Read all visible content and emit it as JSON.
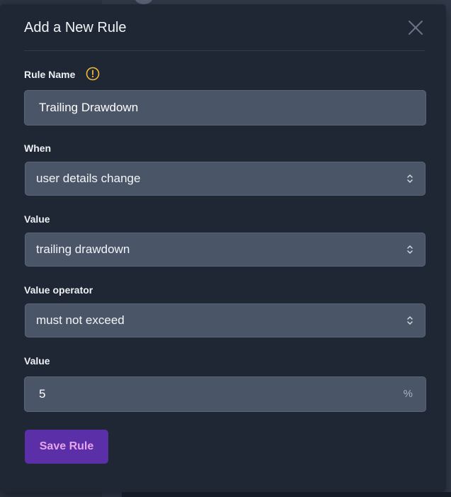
{
  "modal": {
    "title": "Add a New Rule"
  },
  "fields": {
    "rule_name": {
      "label": "Rule Name",
      "value": "Trailing Drawdown"
    },
    "when": {
      "label": "When",
      "selected": "user details change"
    },
    "value_field": {
      "label": "Value",
      "selected": "trailing drawdown"
    },
    "value_operator": {
      "label": "Value operator",
      "selected": "must not exceed"
    },
    "amount": {
      "label": "Value",
      "value": "5",
      "suffix": "%"
    }
  },
  "actions": {
    "save_label": "Save Rule"
  },
  "icons": {
    "close": "close-icon",
    "warning": "warning-circle-icon",
    "select_chevron": "chevron-up-down-icon"
  },
  "colors": {
    "modal_bg": "#1f2735",
    "input_bg": "#4b5568",
    "accent_button": "#5b2fa8",
    "accent_text": "#e8a5e9",
    "warning": "#f2b83a"
  }
}
